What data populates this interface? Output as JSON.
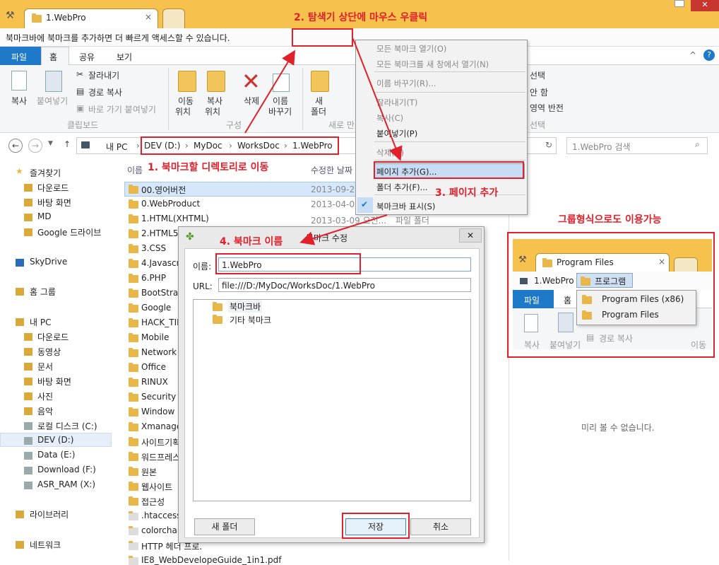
{
  "tab": {
    "title": "1.WebPro"
  },
  "bookmark_hint": "북마크바에 북마크를 추가하면 더 빠르게 액세스할 수 있습니다.",
  "ribbon_tabs": [
    "파일",
    "홈",
    "공유",
    "보기"
  ],
  "ribbon": {
    "copy": "복사",
    "paste": "붙여넣기",
    "cut": "잘라내기",
    "copy_path": "경로 복사",
    "paste_shortcut": "바로 가기 붙여넣기",
    "group_clipboard": "클립보드",
    "move": "이동",
    "move2": "위치",
    "copyto": "복사",
    "copyto2": "위치",
    "delete": "삭제",
    "rename": "이름",
    "rename2": "바꾸기",
    "group_organize": "구성",
    "new": "새",
    "new2": "폴더",
    "group_new": "새로 만",
    "sel1": "선택",
    "sel2": "안 함",
    "sel3": "영역 반전",
    "group_select": "선택"
  },
  "address": {
    "segments": [
      "내 PC",
      "DEV (D:)",
      "MyDoc",
      "WorksDoc",
      "1.WebPro"
    ],
    "search_placeholder": "1.WebPro 검색"
  },
  "columns": {
    "name": "이름",
    "modified": "수정한 날짜"
  },
  "nav": [
    {
      "label": "즐겨찾기",
      "icon": "star-icon"
    },
    {
      "label": "다운로드",
      "icon": "download-icon"
    },
    {
      "label": "바탕 화면",
      "icon": "desktop-icon"
    },
    {
      "label": "MD",
      "icon": "folder-icon"
    },
    {
      "label": "Google 드라이브",
      "icon": "folder-icon"
    },
    {
      "label": "SkyDrive",
      "icon": "cloud-icon"
    },
    {
      "label": "홈 그룹",
      "icon": "homegroup-icon"
    },
    {
      "label": "내 PC",
      "icon": "pc-icon"
    },
    {
      "label": "다운로드",
      "icon": "download-icon"
    },
    {
      "label": "동영상",
      "icon": "video-icon"
    },
    {
      "label": "문서",
      "icon": "document-icon"
    },
    {
      "label": "바탕 화면",
      "icon": "desktop-icon"
    },
    {
      "label": "사진",
      "icon": "picture-icon"
    },
    {
      "label": "음악",
      "icon": "music-icon"
    },
    {
      "label": "로컬 디스크 (C:)",
      "icon": "drive-icon"
    },
    {
      "label": "DEV (D:)",
      "icon": "drive-icon"
    },
    {
      "label": "Data (E:)",
      "icon": "drive-icon"
    },
    {
      "label": "Download (F:)",
      "icon": "drive-icon"
    },
    {
      "label": "ASR_RAM (X:)",
      "icon": "drive-icon"
    },
    {
      "label": "라이브러리",
      "icon": "library-icon"
    },
    {
      "label": "네트워크",
      "icon": "network-icon"
    }
  ],
  "files": [
    "00.영어버전",
    "0.WebProduct",
    "1.HTML(XHTML)",
    "2.HTML5(",
    "3.CSS",
    "4.Javascrip",
    "6.PHP",
    "BootStrap",
    "Google",
    "HACK_TIP",
    "Mobile",
    "Network",
    "Office",
    "RINUX",
    "Security",
    "Window",
    "Xmanager",
    "사이트기획",
    "워드프레스",
    "원본",
    "웹사이트",
    "접근성",
    ".htaccess",
    "colorchart",
    "HTTP 헤더 프로.",
    "IE8_WebDevelopeGuide_1in1.pdf"
  ],
  "file_dates": [
    "2013-09-27",
    "2013-04-03",
    "2013-03-09 오전..."
  ],
  "file_types": [
    "파일 폴더"
  ],
  "context_menu": [
    "모든 북마크 열기(O)",
    "모든 북마크를 새 창에서 열기(N)",
    "이름 바꾸기(R)...",
    "잘라내기(T)",
    "복사(C)",
    "붙여넣기(P)",
    "삭제(D)",
    "페이지 추가(G)...",
    "폴더 추가(F)...",
    "북마크바 표시(S)"
  ],
  "dialog": {
    "title": "북마크 수정",
    "name_label": "이름:",
    "name_value": "1.WebPro",
    "url_label": "URL:",
    "url_value": "file:///D:/MyDoc/WorksDoc/1.WebPro",
    "tree": [
      "북마크바",
      "기타 북마크"
    ],
    "new_folder": "새 폴더",
    "save": "저장",
    "cancel": "취소"
  },
  "preview": {
    "empty": "미리 볼 수 없습니다."
  },
  "inset": {
    "tab": "Program Files",
    "crumb": "1.WebPro",
    "folder": "프로그램",
    "items": [
      "Program Files (x86)",
      "Program Files"
    ],
    "tab_file": "파일",
    "tab_home": "홈",
    "copy": "복사",
    "paste": "붙여넣기",
    "copy_path": "경로 복사",
    "move": "이동"
  },
  "annotations": {
    "a1": "1. 북마크할 디렉토리로 이동",
    "a2": "2. 탐색기 상단에 마우스 우클릭",
    "a3": "3. 페이지 추가",
    "a4": "4. 북마크 이름",
    "a5": "그룹형식으로도 이용가능"
  },
  "colors": {
    "accent": "#1e79c8",
    "red": "#e0202a",
    "tabbar": "#f6c14d"
  }
}
